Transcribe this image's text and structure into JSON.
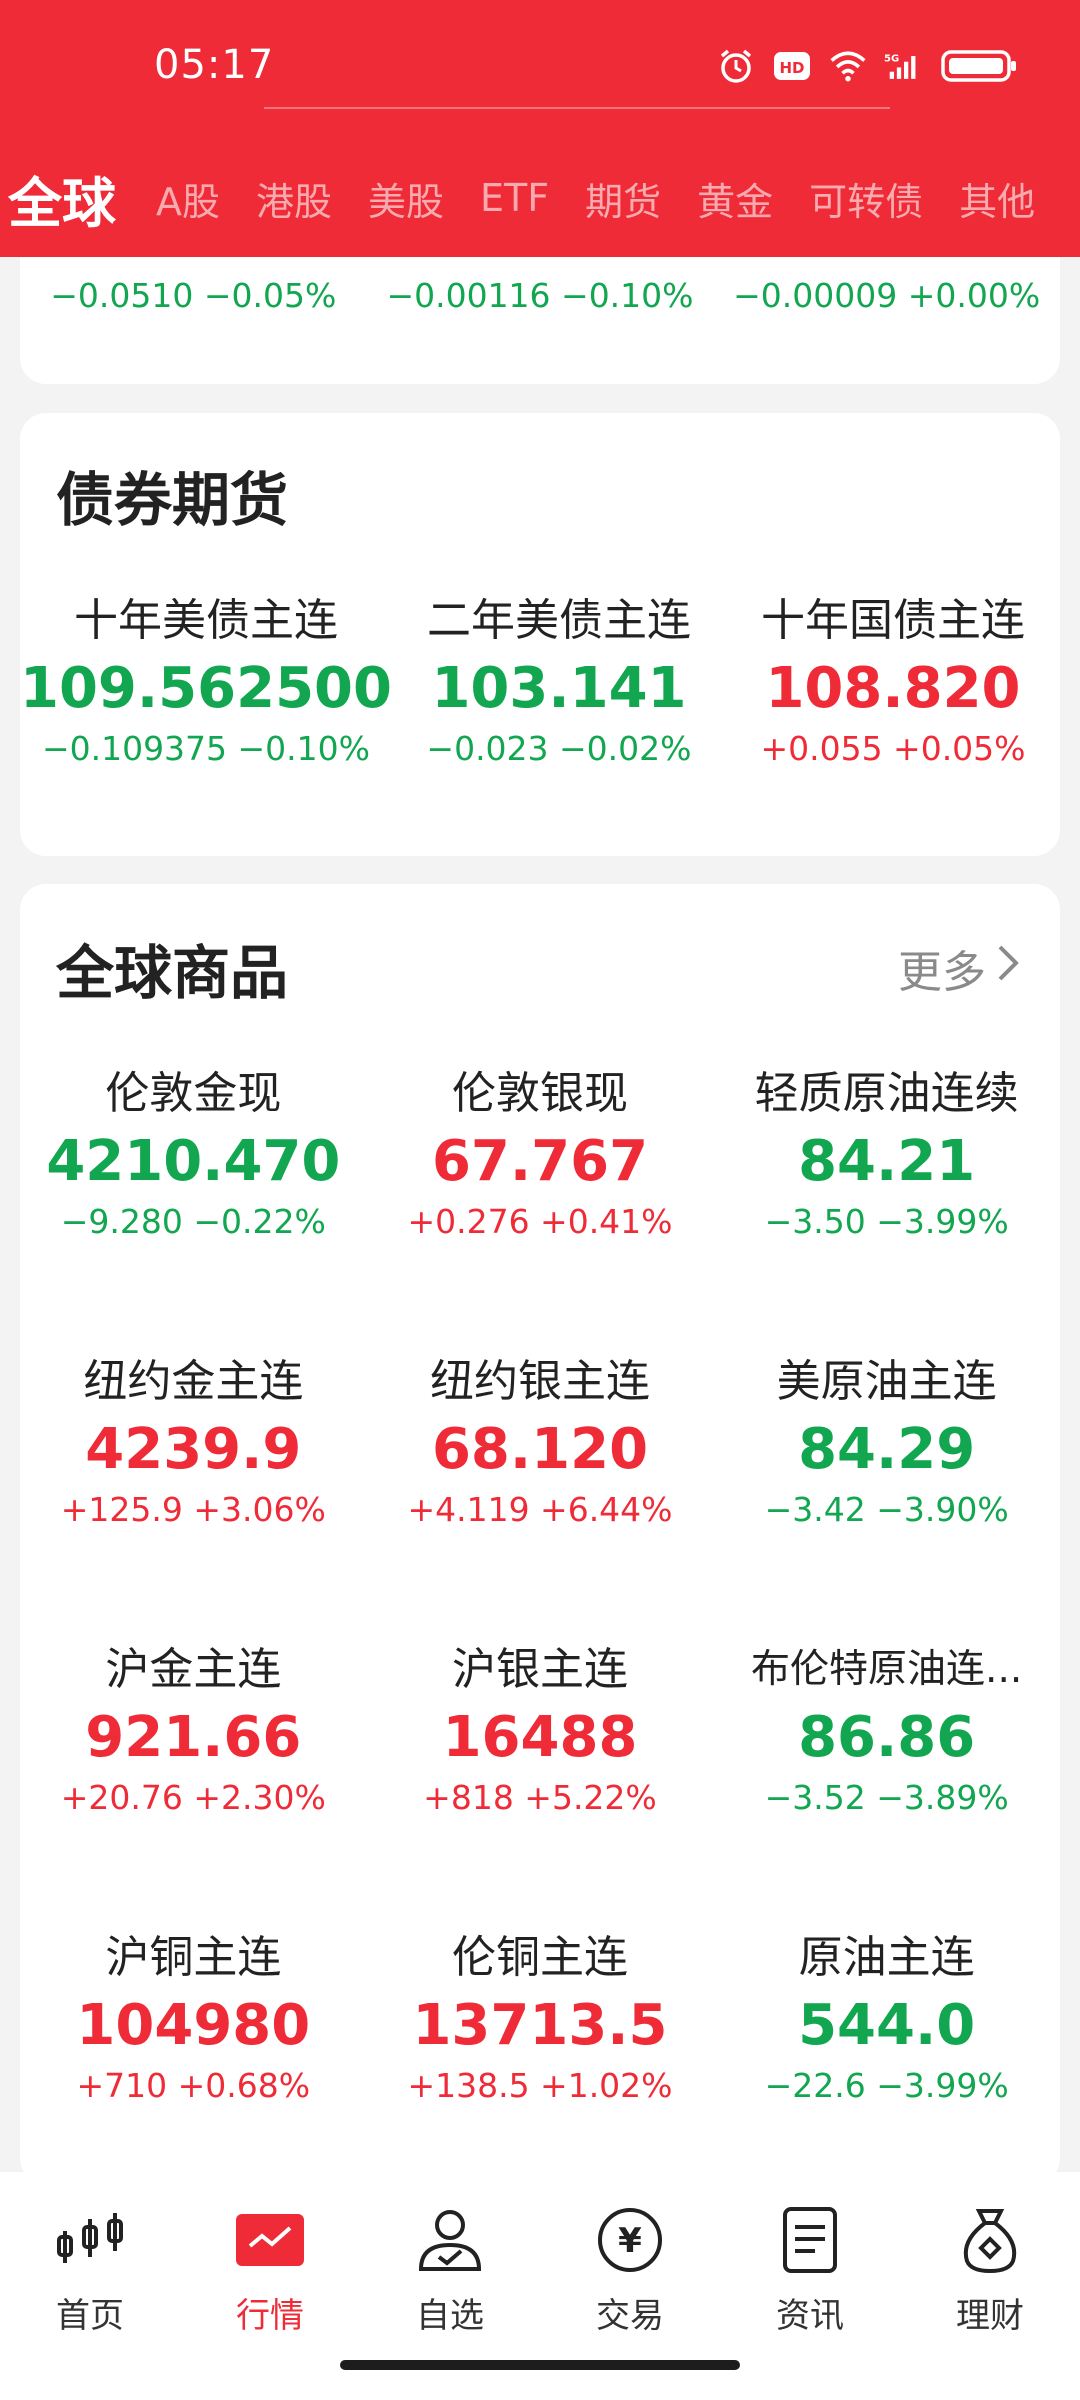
{
  "status_bar": {
    "time": "05:17",
    "icons": [
      "alarm-icon",
      "hd-icon",
      "wifi-icon",
      "5g-signal-icon",
      "battery-icon"
    ]
  },
  "tabs": [
    {
      "label": "全球",
      "active": true
    },
    {
      "label": "A股"
    },
    {
      "label": "港股"
    },
    {
      "label": "美股"
    },
    {
      "label": "ETF"
    },
    {
      "label": "期货"
    },
    {
      "label": "黄金"
    },
    {
      "label": "可转债"
    },
    {
      "label": "其他"
    }
  ],
  "forex_partial": {
    "items": [
      {
        "change": "−0.0510 −0.05%",
        "direction": "down"
      },
      {
        "change": "−0.00116 −0.10%",
        "direction": "down"
      },
      {
        "change": "−0.00009 +0.00%",
        "direction": "down"
      }
    ]
  },
  "bond_futures": {
    "title": "债券期货",
    "items": [
      {
        "name": "十年美债主连",
        "price": "109.562500",
        "change": "−0.109375 −0.10%",
        "direction": "down"
      },
      {
        "name": "二年美债主连",
        "price": "103.141",
        "change": "−0.023 −0.02%",
        "direction": "down"
      },
      {
        "name": "十年国债主连",
        "price": "108.820",
        "change": "+0.055 +0.05%",
        "direction": "up"
      }
    ]
  },
  "commodities": {
    "title": "全球商品",
    "more_label": "更多",
    "items": [
      {
        "name": "伦敦金现",
        "price": "4210.470",
        "change": "−9.280 −0.22%",
        "direction": "down"
      },
      {
        "name": "伦敦银现",
        "price": "67.767",
        "change": "+0.276 +0.41%",
        "direction": "up"
      },
      {
        "name": "轻质原油连续",
        "price": "84.21",
        "change": "−3.50 −3.99%",
        "direction": "down"
      },
      {
        "name": "纽约金主连",
        "price": "4239.9",
        "change": "+125.9 +3.06%",
        "direction": "up"
      },
      {
        "name": "纽约银主连",
        "price": "68.120",
        "change": "+4.119 +6.44%",
        "direction": "up"
      },
      {
        "name": "美原油主连",
        "price": "84.29",
        "change": "−3.42 −3.90%",
        "direction": "down"
      },
      {
        "name": "沪金主连",
        "price": "921.66",
        "change": "+20.76 +2.30%",
        "direction": "up"
      },
      {
        "name": "沪银主连",
        "price": "16488",
        "change": "+818 +5.22%",
        "direction": "up"
      },
      {
        "name": "布伦特原油连...",
        "price": "86.86",
        "change": "−3.52 −3.89%",
        "direction": "down"
      },
      {
        "name": "沪铜主连",
        "price": "104980",
        "change": "+710 +0.68%",
        "direction": "up"
      },
      {
        "name": "伦铜主连",
        "price": "13713.5",
        "change": "+138.5 +1.02%",
        "direction": "up"
      },
      {
        "name": "原油主连",
        "price": "544.0",
        "change": "−22.6 −3.99%",
        "direction": "down"
      }
    ]
  },
  "bottom_nav": [
    {
      "label": "首页",
      "icon": "home-candlestick-icon"
    },
    {
      "label": "行情",
      "icon": "market-chart-icon",
      "active": true
    },
    {
      "label": "自选",
      "icon": "watchlist-person-icon"
    },
    {
      "label": "交易",
      "icon": "trade-yen-icon"
    },
    {
      "label": "资讯",
      "icon": "news-document-icon"
    },
    {
      "label": "理财",
      "icon": "wealth-bag-icon"
    }
  ],
  "colors": {
    "brand_red": "#ee2b37",
    "up": "#ee2b37",
    "down": "#12a650"
  }
}
